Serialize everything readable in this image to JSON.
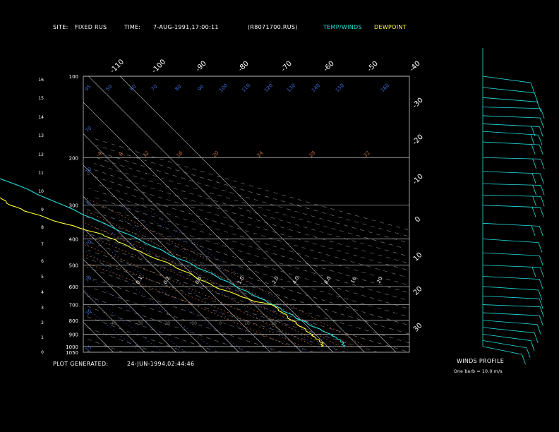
{
  "header": {
    "site_label": "SITE:",
    "site_value": "FIXED RUS",
    "time_label": "TIME:",
    "time_value": "7-AUG-1991,17:00:11",
    "file": "(R8071700.RUS)",
    "temp_winds_label": "TEMP/WINDS",
    "dewpoint_label": "DEWPOINT"
  },
  "footer": {
    "generated_label": "PLOT GENERATED:",
    "generated_value": "24-JUN-1994,02:44:46",
    "winds_profile_label": "WINDS PROFILE",
    "barb_note": "One barb = 10.0 m/s"
  },
  "colors": {
    "background": "#000000",
    "temp": "#22e0e0",
    "dewpoint": "#ffff33",
    "isotherm": "#c8c8c8",
    "pressure_line": "#c8c8c8",
    "dry_adiabat": "#7f7f7f",
    "mixing_ratio": "#3c6cd8",
    "moist_adiabat": "#c86a3c",
    "axis_text": "#ffffff",
    "winds": "#22e0e0"
  },
  "chart_data": {
    "type": "line",
    "subtype": "skew-T log-p",
    "y_axis": {
      "pressure_range_hPa": [
        1050,
        100
      ],
      "log_scale": true,
      "pressure_ticks_hPa": [
        100,
        200,
        300,
        400,
        500,
        600,
        700,
        800,
        900,
        1000,
        1050
      ],
      "height_ticks_km": [
        0,
        1,
        2,
        3,
        4,
        5,
        6,
        7,
        8,
        9,
        10,
        11,
        12,
        13,
        14,
        15,
        16
      ]
    },
    "top_temperature_labels": [
      -110,
      -100,
      -90,
      -80,
      -70,
      -60,
      -50,
      -40
    ],
    "right_temperature_labels": [
      -30,
      -20,
      -10,
      0,
      10,
      20,
      30
    ],
    "isotherms_C": [
      -120,
      -110,
      -100,
      -90,
      -80,
      -70,
      -60,
      -50,
      -40,
      -30,
      -20,
      -10,
      0,
      10,
      20,
      30,
      40
    ],
    "dry_adiabat_labels": [
      -40,
      -30,
      -20,
      -10,
      0,
      10,
      20
    ],
    "mixing_ratio_labels": [
      "0.1",
      "0.2",
      "0.4",
      "1.0",
      "2.0",
      "4.0",
      "8.0",
      "16",
      "20"
    ],
    "moist_adiabat_labels": [
      -4,
      8,
      12,
      16,
      20,
      24,
      28,
      32
    ],
    "top_row_labels": [
      95,
      50,
      60,
      70,
      80,
      90,
      100,
      110,
      120,
      130,
      140,
      150,
      160
    ],
    "left_column_labels": [
      70,
      10,
      0,
      70,
      70,
      30,
      15
    ],
    "series": [
      {
        "name": "TEMP/WINDS",
        "points": [
          [
            1000,
            25
          ],
          [
            975,
            26
          ],
          [
            950,
            26.2
          ],
          [
            925,
            25.6
          ],
          [
            900,
            25
          ],
          [
            850,
            22.2
          ],
          [
            800,
            20
          ],
          [
            750,
            17.9
          ],
          [
            700,
            15.9
          ],
          [
            650,
            13
          ],
          [
            600,
            10
          ],
          [
            550,
            7
          ],
          [
            500,
            3.2
          ],
          [
            450,
            -1.5
          ],
          [
            400,
            -6
          ],
          [
            350,
            -12
          ],
          [
            300,
            -19
          ],
          [
            250,
            -28
          ],
          [
            200,
            -41
          ],
          [
            180,
            -46
          ],
          [
            160,
            -52
          ],
          [
            150,
            -56
          ],
          [
            140,
            -60
          ],
          [
            130,
            -61
          ],
          [
            120,
            -57
          ],
          [
            110,
            -53
          ],
          [
            100,
            -50
          ]
        ]
      },
      {
        "name": "DEWPOINT",
        "points": [
          [
            1000,
            18
          ],
          [
            975,
            19.5
          ],
          [
            950,
            19.4
          ],
          [
            925,
            19
          ],
          [
            900,
            18.9
          ],
          [
            850,
            18.1
          ],
          [
            800,
            17
          ],
          [
            750,
            16.5
          ],
          [
            700,
            15.5
          ],
          [
            680,
            11
          ],
          [
            650,
            8.2
          ],
          [
            600,
            3
          ],
          [
            550,
            0
          ],
          [
            500,
            -3.5
          ],
          [
            450,
            -9
          ],
          [
            420,
            -12
          ],
          [
            400,
            -14
          ],
          [
            380,
            -17
          ],
          [
            350,
            -25
          ],
          [
            320,
            -32
          ],
          [
            300,
            -36
          ],
          [
            280,
            -37
          ],
          [
            260,
            -39
          ],
          [
            250,
            -39
          ],
          [
            240,
            -40
          ],
          [
            230,
            -42
          ],
          [
            220,
            -43
          ],
          [
            210,
            -44
          ],
          [
            200,
            -45
          ]
        ]
      }
    ],
    "winds_profile": {
      "units": "m/s",
      "barb_value": 10.0,
      "levels_hPa": [
        1000,
        950,
        900,
        850,
        800,
        750,
        700,
        650,
        600,
        550,
        500,
        450,
        400,
        350,
        300,
        275,
        250,
        225,
        200,
        175,
        160,
        150,
        140,
        130,
        120,
        110,
        100
      ],
      "direction_deg": [
        200,
        210,
        220,
        230,
        240,
        250,
        255,
        250,
        245,
        250,
        255,
        250,
        245,
        250,
        255,
        260,
        260,
        255,
        260,
        250,
        245,
        250,
        255,
        260,
        240,
        230,
        220
      ],
      "speed_ms": [
        4,
        6,
        8,
        10,
        10,
        12,
        14,
        12,
        12,
        14,
        15,
        14,
        14,
        16,
        20,
        22,
        24,
        24,
        22,
        20,
        18,
        16,
        14,
        10,
        8,
        6,
        4
      ]
    }
  }
}
